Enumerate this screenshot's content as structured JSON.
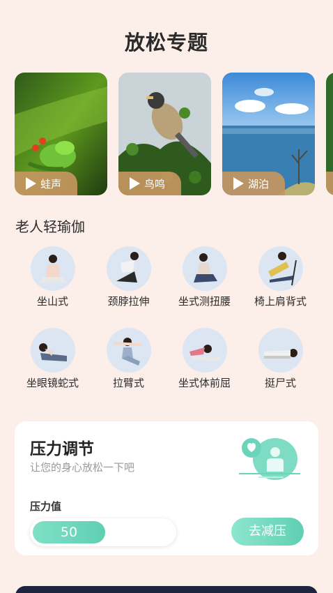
{
  "page": {
    "title": "放松专题"
  },
  "sounds": [
    {
      "label": "蛙声"
    },
    {
      "label": "鸟鸣"
    },
    {
      "label": "湖泊"
    }
  ],
  "yoga": {
    "title": "老人轻瑜伽",
    "items": [
      {
        "label": "坐山式"
      },
      {
        "label": "颈脖拉伸"
      },
      {
        "label": "坐式测扭腰"
      },
      {
        "label": "椅上肩背式"
      },
      {
        "label": "坐眼镜蛇式"
      },
      {
        "label": "拉臂式"
      },
      {
        "label": "坐式体前屈"
      },
      {
        "label": "挺尸式"
      }
    ]
  },
  "stress": {
    "title": "压力调节",
    "subtitle": "让您的身心放松一下吧",
    "value_label": "压力值",
    "value": "50",
    "button": "去减压"
  },
  "colors": {
    "background": "#fcefe9",
    "accent": "#5fcfb3",
    "pill": "#c49660"
  }
}
